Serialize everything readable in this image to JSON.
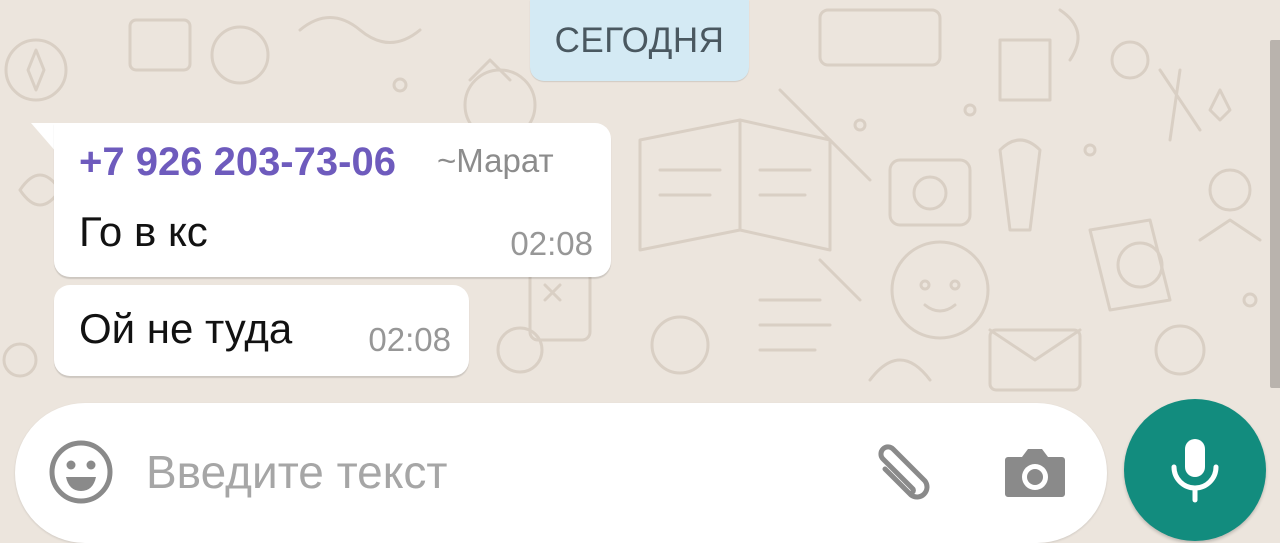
{
  "chat": {
    "date_separator": "СЕГОДНЯ",
    "messages": [
      {
        "sender_phone": "+7 926 203-73-06",
        "sender_name": "~Марат",
        "text": "Го в кс",
        "time": "02:08"
      },
      {
        "text": "Ой не туда",
        "time": "02:08"
      }
    ]
  },
  "composer": {
    "placeholder": "Введите текст",
    "icons": {
      "emoji": "emoji-icon",
      "attach": "paperclip-icon",
      "camera": "camera-icon",
      "mic": "microphone-icon"
    }
  },
  "colors": {
    "background": "#ece5dd",
    "date_chip": "#d4eaf4",
    "sender_name": "#6e5bbd",
    "mic_button": "#128c7e",
    "icon_gray": "#8a8a8a"
  }
}
